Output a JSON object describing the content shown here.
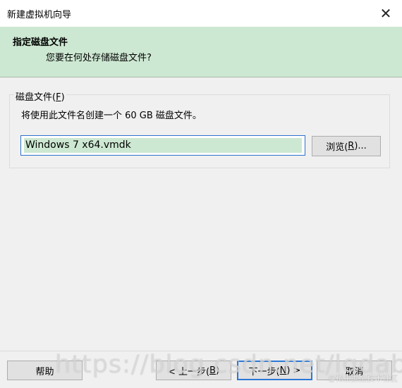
{
  "window": {
    "title": "新建虚拟机向导",
    "close_glyph": "✕"
  },
  "header": {
    "title": "指定磁盘文件",
    "subtitle": "您要在何处存储磁盘文件?"
  },
  "disk_file_group": {
    "label": "磁盘文件(",
    "label_accel": "F",
    "label_end": ")",
    "description": "将使用此文件名创建一个 60 GB 磁盘文件。",
    "file_value": "Windows 7 x64.vmdk",
    "browse_label": "浏览(",
    "browse_accel": "R",
    "browse_end": ")..."
  },
  "footer": {
    "help_label": "帮助",
    "back_label": "< 上一步(",
    "back_accel": "B",
    "back_end": ")",
    "next_label": "下一步(",
    "next_accel": "N",
    "next_end": ") >",
    "cancel_label": "取消"
  },
  "watermarks": {
    "url": "https://blog.csdn.net/lgdabc",
    "credit": "@稀土掘金技术社区"
  }
}
